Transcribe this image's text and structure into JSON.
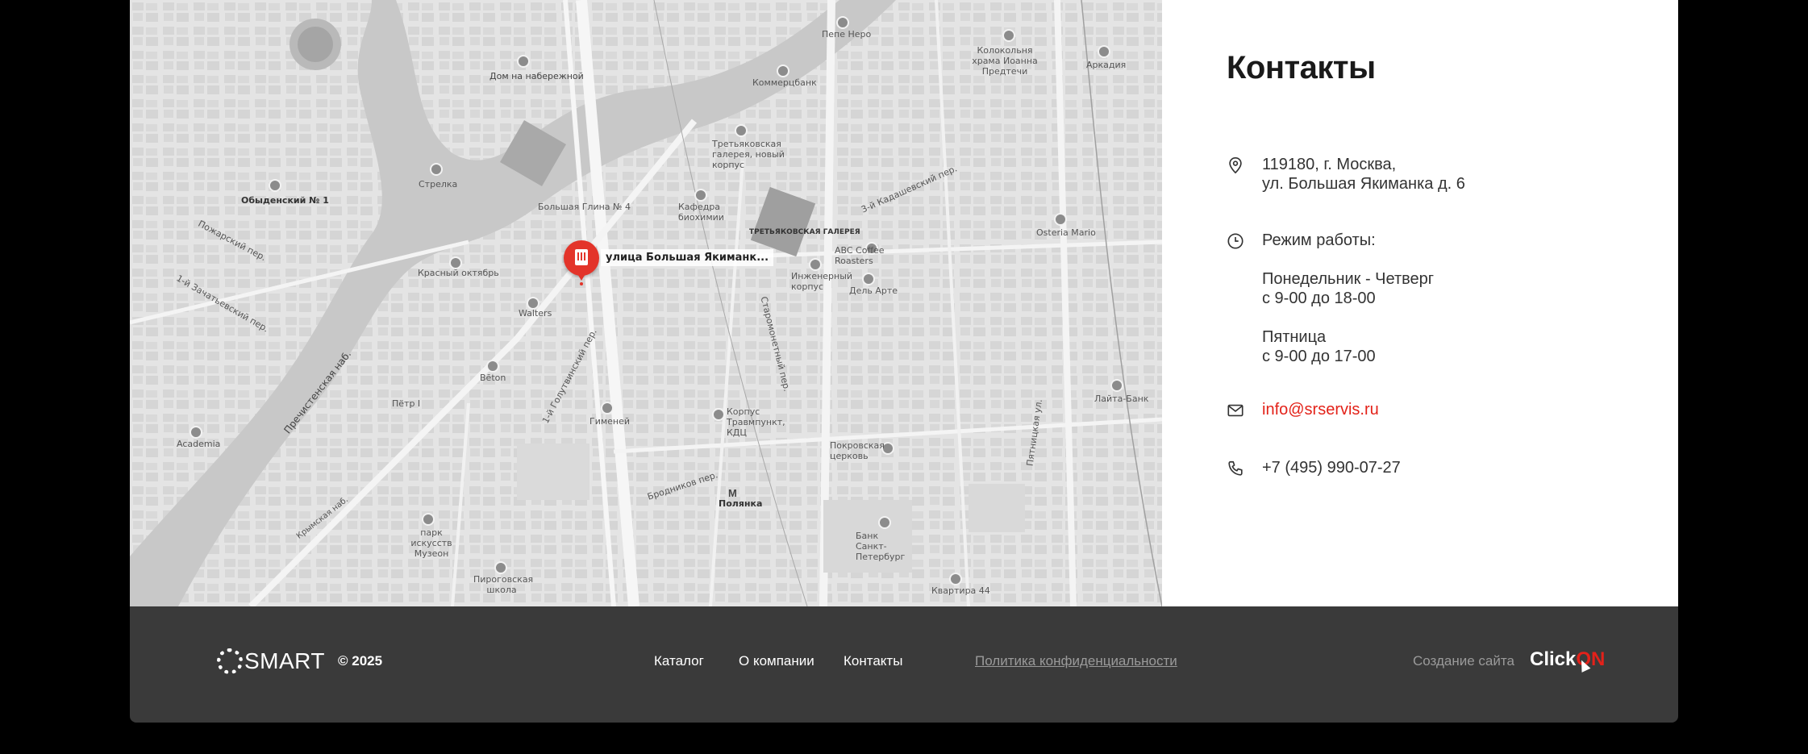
{
  "map": {
    "marker_label": "улица Большая Якиманк...",
    "labels": [
      {
        "text": "Дом на набережной",
        "l2": "набережной"
      },
      {
        "text": "Обыденский № 1"
      },
      {
        "text": "Стрелка"
      },
      {
        "text": "Большая Глина № 4"
      },
      {
        "text": "Красный октябрь"
      },
      {
        "text": "Walters"
      },
      {
        "text": "Bēton"
      },
      {
        "text": "Пётр I"
      },
      {
        "text": "Academia"
      },
      {
        "text": "Гименей"
      },
      {
        "text": "Коммерцбанк"
      },
      {
        "text": "Пепе Неро"
      },
      {
        "text": "Колокольня храма Иоанна Предтечи"
      },
      {
        "text": "Аркадия"
      },
      {
        "text": "Третьяковская галерея, новый корпус"
      },
      {
        "text": "Кафедра биохимии"
      },
      {
        "text": "ТРЕТЬЯКОВСКАЯ ГАЛЕРЕЯ"
      },
      {
        "text": "ABC Coffee Roasters"
      },
      {
        "text": "Инженерный корпус"
      },
      {
        "text": "Дель Арте"
      },
      {
        "text": "Osteria Mario"
      },
      {
        "text": "Корпус Травмпункт, КДЦ"
      },
      {
        "text": "Покровская церковь"
      },
      {
        "text": "Полянка"
      },
      {
        "text": "Банк Санкт-Петербург"
      },
      {
        "text": "Лайта-Банк"
      },
      {
        "text": "Квартира 44"
      },
      {
        "text": "парк искусств Музеон"
      },
      {
        "text": "Пироговская школа"
      },
      {
        "text": "Пречистенская наб."
      },
      {
        "text": "Пожарский пер."
      },
      {
        "text": "1-й Зачатьевский пер."
      },
      {
        "text": "1-й Голутвинский пер."
      },
      {
        "text": "Старомонетный пер."
      },
      {
        "text": "3-й Кадашевский пер."
      },
      {
        "text": "Пятницкая ул."
      },
      {
        "text": "Бродников пер."
      },
      {
        "text": "Крымская наб."
      }
    ]
  },
  "contacts": {
    "title": "Контакты",
    "address_line1": "119180, г. Москва,",
    "address_line2": "ул. Большая Якиманка д. 6",
    "hours_title": "Режим работы:",
    "hours_mon_thu": "Понедельник - Четверг",
    "hours_mon_thu_time": "с 9-00 до 18-00",
    "hours_fri": "Пятница",
    "hours_fri_time": "с 9-00 до 17-00",
    "email": "info@srservis.ru",
    "phone": "+7 (495) 990-07-27"
  },
  "footer": {
    "logo": "SMART",
    "copyright": "© 2025",
    "nav": [
      "Каталог",
      "О компании",
      "Контакты"
    ],
    "policy": "Политика конфиденциальности",
    "made_by": "Создание сайта",
    "studio_a": "Click",
    "studio_b": "ON",
    "accent": "#e3211a"
  }
}
